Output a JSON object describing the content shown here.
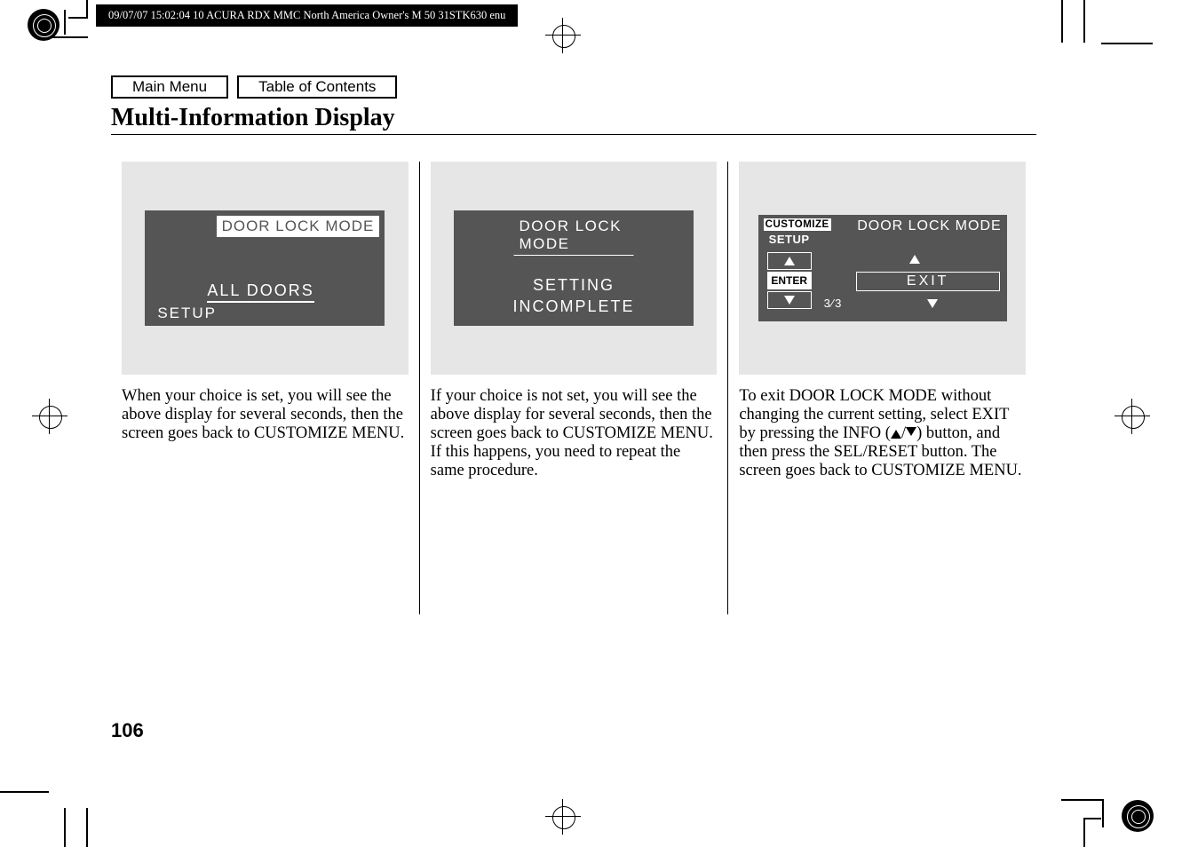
{
  "header": {
    "strip": "09/07/07 15:02:04    10 ACURA RDX MMC North America Owner's M 50 31STK630 enu"
  },
  "nav": {
    "main_menu": "Main Menu",
    "toc": "Table of Contents"
  },
  "title": "Multi-Information Display",
  "illustration1": {
    "title": "DOOR LOCK MODE",
    "value": "ALL DOORS",
    "setup": "SETUP"
  },
  "illustration2": {
    "title": "DOOR LOCK MODE",
    "line1": "SETTING",
    "line2": "INCOMPLETE"
  },
  "illustration3": {
    "badge": "CUSTOMIZE",
    "title": "DOOR LOCK MODE",
    "setup": "SETUP",
    "enter": "ENTER",
    "exit": "EXIT",
    "fraction": "3⁄3"
  },
  "column1_text": "When your choice is set, you will see the above display for several seconds, then the screen goes back to CUSTOMIZE MENU.",
  "column2_text": "If your choice is not set, you will see the above display for several seconds, then the screen goes back to CUSTOMIZE MENU. If this happens, you need to repeat the same procedure.",
  "column3_text_pre": "To exit DOOR LOCK MODE without changing the current setting, select EXIT by pressing the INFO (",
  "column3_text_post": ") button, and then press the SEL/RESET button. The screen goes back to CUSTOMIZE MENU.",
  "page_number": "106"
}
